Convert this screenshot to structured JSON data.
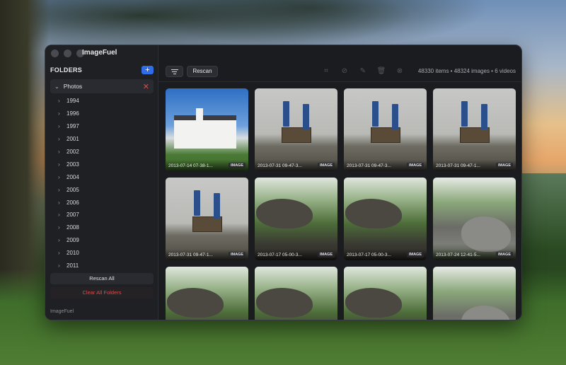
{
  "window": {
    "title": "ImageFuel"
  },
  "sidebar": {
    "title": "FOLDERS",
    "add_label": "+",
    "root_folder": {
      "label": "Photos",
      "remove_label": "✕"
    },
    "years": [
      "1994",
      "1996",
      "1997",
      "2001",
      "2002",
      "2003",
      "2004",
      "2005",
      "2006",
      "2007",
      "2008",
      "2009",
      "2010",
      "2011"
    ],
    "rescan_all_label": "Rescan All",
    "clear_all_label": "Clear All Folders",
    "footer": "ImageFuel"
  },
  "toolbar": {
    "rescan_label": "Rescan",
    "icons": [
      "crop-icon",
      "hide-icon",
      "edit-icon",
      "trash-icon",
      "close-circle-icon"
    ],
    "counts": "48330 items • 48324 images • 6 videos"
  },
  "grid": {
    "items": [
      {
        "name": "2013-07-14 07-38-1...",
        "badge": "IMAGE",
        "scene": "church"
      },
      {
        "name": "2013-07-31 09-47-3...",
        "badge": "IMAGE",
        "scene": "summit"
      },
      {
        "name": "2013-07-31 09-47-3...",
        "badge": "IMAGE",
        "scene": "summit"
      },
      {
        "name": "2013-07-31 09-47-1...",
        "badge": "IMAGE",
        "scene": "summit"
      },
      {
        "name": "2013-07-31 09-47-1...",
        "badge": "IMAGE",
        "scene": "summit"
      },
      {
        "name": "2013-07-17 05-00-3...",
        "badge": "IMAGE",
        "scene": "forest"
      },
      {
        "name": "2013-07-17 05-00-3...",
        "badge": "IMAGE",
        "scene": "forest"
      },
      {
        "name": "2013-07-24 12-41-5...",
        "badge": "IMAGE",
        "scene": "rocks"
      },
      {
        "name": "",
        "badge": "",
        "scene": "forest"
      },
      {
        "name": "",
        "badge": "",
        "scene": "forest"
      },
      {
        "name": "",
        "badge": "",
        "scene": "forest"
      },
      {
        "name": "",
        "badge": "",
        "scene": "rocks"
      }
    ]
  },
  "colors": {
    "accent": "#2f6ee8",
    "danger": "#e04848",
    "window_bg": "#1b1c20",
    "sidebar_bg": "#1f2024"
  }
}
